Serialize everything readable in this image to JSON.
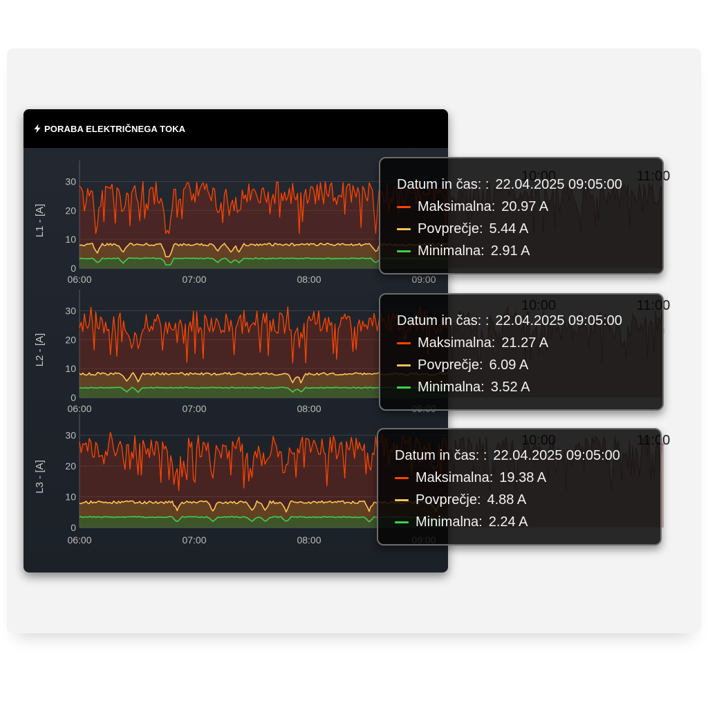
{
  "widget": {
    "title": "PORABA ELEKTRIČNEGA TOKA",
    "icon": "lightning-bolt-icon"
  },
  "colors": {
    "max": "#ff4500",
    "avg": "#ffc456",
    "min": "#3fd04f",
    "text": "#bdbdbd"
  },
  "chart_data": [
    {
      "type": "area",
      "ylabel": "L1 - [A]",
      "ylim": [
        0,
        33
      ],
      "yticks": [
        0,
        10,
        20,
        30
      ],
      "x_ticks": [
        "06:00",
        "07:00",
        "08:00",
        "09:00",
        "10:00",
        "11:00"
      ],
      "grid": true,
      "series": [
        {
          "name": "Maksimalna",
          "color": "#ff4500",
          "typical_range": [
            15,
            32
          ]
        },
        {
          "name": "Povprečje",
          "color": "#ffc456",
          "typical_range": [
            6,
            9
          ]
        },
        {
          "name": "Minimalna",
          "color": "#3fd04f",
          "typical_range": [
            2,
            4
          ]
        }
      ],
      "tooltip": {
        "date_label": "Datum in čas: :",
        "date": "22.04.2025 09:05:00",
        "max": "20.97 A",
        "avg": "5.44 A",
        "min": "2.91 A"
      }
    },
    {
      "type": "area",
      "ylabel": "L2 - [A]",
      "ylim": [
        0,
        33
      ],
      "yticks": [
        0,
        10,
        20,
        30
      ],
      "x_ticks": [
        "06:00",
        "07:00",
        "08:00",
        "09:00",
        "10:00",
        "11:00"
      ],
      "grid": true,
      "series": [
        {
          "name": "Maksimalna",
          "color": "#ff4500",
          "typical_range": [
            15,
            32
          ]
        },
        {
          "name": "Povprečje",
          "color": "#ffc456",
          "typical_range": [
            6,
            9
          ]
        },
        {
          "name": "Minimalna",
          "color": "#3fd04f",
          "typical_range": [
            2,
            4
          ]
        }
      ],
      "tooltip": {
        "date_label": "Datum in čas: :",
        "date": "22.04.2025 09:05:00",
        "max": "21.27 A",
        "avg": "6.09 A",
        "min": "3.52 A"
      }
    },
    {
      "type": "area",
      "ylabel": "L3 - [A]",
      "ylim": [
        0,
        33
      ],
      "yticks": [
        0,
        10,
        20,
        30
      ],
      "x_ticks": [
        "06:00",
        "07:00",
        "08:00",
        "09:00",
        "10:00",
        "11:00"
      ],
      "grid": true,
      "series": [
        {
          "name": "Maksimalna",
          "color": "#ff4500",
          "typical_range": [
            15,
            32
          ]
        },
        {
          "name": "Povprečje",
          "color": "#ffc456",
          "typical_range": [
            6,
            9
          ]
        },
        {
          "name": "Minimalna",
          "color": "#3fd04f",
          "typical_range": [
            2,
            4
          ]
        }
      ],
      "tooltip": {
        "date_label": "Datum in čas: :",
        "date": "22.04.2025 09:05:00",
        "max": "19.38 A",
        "avg": "4.88 A",
        "min": "2.24 A"
      }
    }
  ]
}
